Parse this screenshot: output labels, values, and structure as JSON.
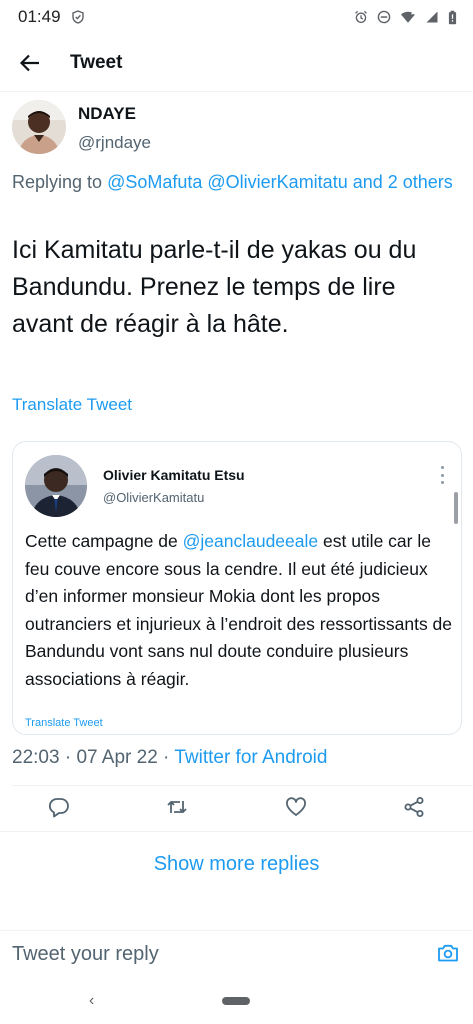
{
  "status_bar": {
    "time": "01:49"
  },
  "app_bar": {
    "title": "Tweet"
  },
  "tweet": {
    "display_name": "NDAYE",
    "handle": "@rjndaye",
    "replying_prefix": "Replying to",
    "replying_mentions": "@SoMafuta @OlivierKamitatu and 2 others",
    "text": "Ici Kamitatu parle-t-il de yakas ou du Bandundu. Prenez le temps de lire avant de réagir à la hâte.",
    "translate_label": "Translate Tweet",
    "time": "22:03",
    "date": "07 Apr 22",
    "source": "Twitter for Android",
    "meta_sep": " · "
  },
  "quote": {
    "display_name": "Olivier Kamitatu Etsu",
    "handle": "@OlivierKamitatu",
    "text_before": "Cette campagne de ",
    "mention": "@jeanclaudeeale",
    "text_after": " est utile car le feu couve encore sous la cendre. Il eut été judicieux d’en informer monsieur Mokia dont les propos outranciers et injurieux à l’endroit des ressortissants de Bandundu vont sans nul doute conduire plusieurs associations à réagir.",
    "translate_label": "Translate Tweet"
  },
  "show_more": "Show more replies",
  "reply_bar": {
    "placeholder": "Tweet your reply"
  },
  "nav": {
    "back_glyph": "‹"
  },
  "colors": {
    "accent": "#1d9bf0",
    "secondary_text": "#536471",
    "primary_text": "#0f1419"
  }
}
